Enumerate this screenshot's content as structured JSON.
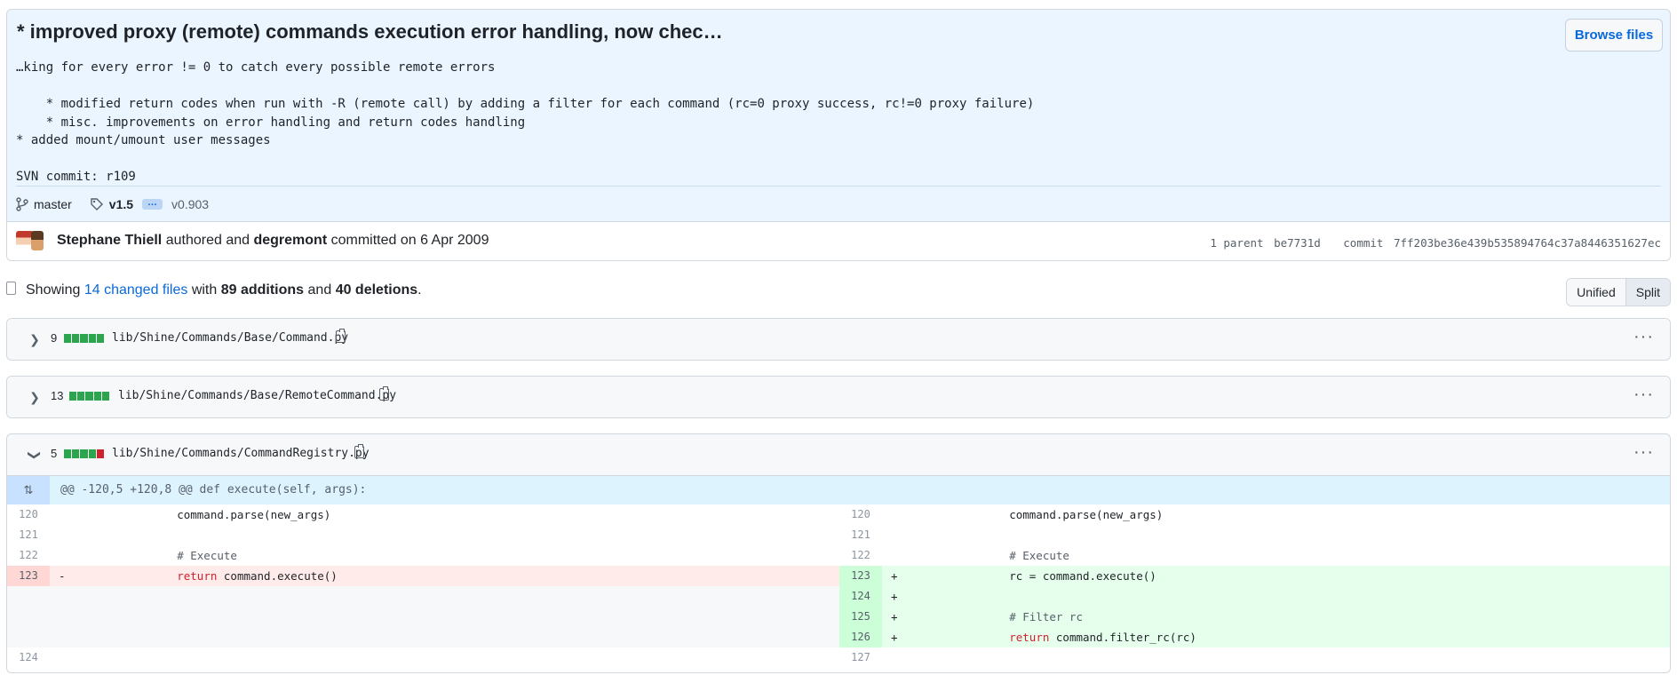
{
  "commit": {
    "title": "* improved proxy (remote) commands execution error handling, now chec…",
    "browse_files_label": "Browse files",
    "description": "…king for every error != 0 to catch every possible remote errors\n\n    * modified return codes when run with -R (remote call) by adding a filter for each command (rc=0 proxy success, rc!=0 proxy failure)\n    * misc. improvements on error handling and return codes handling\n* added mount/umount user messages\n\nSVN commit: r109",
    "branch": "master",
    "tag": "v1.5",
    "tag_ellipsis": "…",
    "tag_last": "v0.903",
    "author": "Stephane Thiell",
    "authored_text": "authored and",
    "committer": "degremont",
    "committed_text": "committed on 6 Apr 2009",
    "parent_label": "1 parent",
    "parent_sha": "be7731d",
    "commit_label": "commit",
    "commit_sha": "7ff203be36e439b535894764c37a8446351627ec"
  },
  "summary": {
    "showing": "Showing",
    "changed_files": "14 changed files",
    "with": "with",
    "additions": "89 additions",
    "and": "and",
    "deletions": "40 deletions",
    "period": "."
  },
  "view_toggle": {
    "unified": "Unified",
    "split": "Split",
    "selected": "Split"
  },
  "files": [
    {
      "count": "9",
      "path": "lib/Shine/Commands/Base/Command.py",
      "expanded": false,
      "blocks": [
        "add",
        "add",
        "add",
        "add",
        "add"
      ]
    },
    {
      "count": "13",
      "path": "lib/Shine/Commands/Base/RemoteCommand.py",
      "expanded": false,
      "blocks": [
        "add",
        "add",
        "add",
        "add",
        "add"
      ]
    },
    {
      "count": "5",
      "path": "lib/Shine/Commands/CommandRegistry.py",
      "expanded": true,
      "blocks": [
        "add",
        "add",
        "add",
        "add",
        "del"
      ]
    }
  ],
  "hunk_header": "@@ -120,5 +120,8 @@ def execute(self, args):",
  "diff": {
    "left": [
      {
        "ln": "120",
        "type": "ctx",
        "marker": "",
        "code": "        command.parse(new_args)"
      },
      {
        "ln": "121",
        "type": "ctx",
        "marker": "",
        "code": ""
      },
      {
        "ln": "122",
        "type": "ctx",
        "marker": "",
        "code": "        # Execute"
      },
      {
        "ln": "123",
        "type": "del",
        "marker": "-",
        "kw": "return",
        "code": " command.execute()"
      },
      {
        "ln": "",
        "type": "empty",
        "marker": "",
        "code": ""
      },
      {
        "ln": "",
        "type": "empty",
        "marker": "",
        "code": ""
      },
      {
        "ln": "",
        "type": "empty",
        "marker": "",
        "code": ""
      },
      {
        "ln": "124",
        "type": "ctx",
        "marker": "",
        "code": ""
      }
    ],
    "right": [
      {
        "ln": "120",
        "type": "ctx",
        "marker": "",
        "code": "        command.parse(new_args)"
      },
      {
        "ln": "121",
        "type": "ctx",
        "marker": "",
        "code": ""
      },
      {
        "ln": "122",
        "type": "ctx",
        "marker": "",
        "code": "        # Execute"
      },
      {
        "ln": "123",
        "type": "add",
        "marker": "+",
        "code": "        rc = command.execute()"
      },
      {
        "ln": "124",
        "type": "add",
        "marker": "+",
        "code": ""
      },
      {
        "ln": "125",
        "type": "add",
        "marker": "+",
        "code": "        # Filter rc"
      },
      {
        "ln": "126",
        "type": "add",
        "marker": "+",
        "kw": "return",
        "code": " command.filter_rc(rc)"
      },
      {
        "ln": "127",
        "type": "ctx",
        "marker": "",
        "code": ""
      }
    ]
  }
}
